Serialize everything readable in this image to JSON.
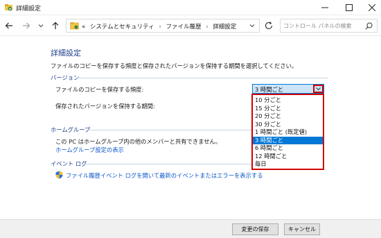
{
  "window": {
    "title": "詳細設定"
  },
  "address": {
    "overflow": "«",
    "crumbs": [
      "システムとセキュリティ",
      "ファイル履歴",
      "詳細設定"
    ],
    "separator": "›"
  },
  "search": {
    "placeholder": "コントロール パネルの検索"
  },
  "main": {
    "title": "詳細設定",
    "description": "ファイルのコピーを保存する頻度と保存されたバージョンを保持する期間を選択してください。",
    "versions": {
      "header": "バージョン",
      "frequency_label": "ファイルのコピーを保存する頻度:",
      "retention_label": "保存されたバージョンを保持する期間:",
      "frequency_value": "3 時間ごと",
      "options": [
        "10 分ごと",
        "15 分ごと",
        "20 分ごと",
        "30 分ごと",
        "1 時間ごと (既定値)",
        "3 時間ごと",
        "6 時間ごと",
        "12 時間ごと",
        "毎日"
      ],
      "selected_index": 5
    },
    "homegroup": {
      "header": "ホームグループ",
      "text": "この PC はホームグループ内の他のメンバーと共有できません。",
      "link": "ホームグループ設定の表示"
    },
    "eventlog": {
      "header": "イベント ログ",
      "link": "ファイル履歴イベント ログを開いて最新のイベントまたはエラーを表示する"
    }
  },
  "footer": {
    "save_label": "変更の保存",
    "cancel_label": "キャンセル"
  },
  "colors": {
    "heading": "#1e3f8a",
    "link": "#0b57c9",
    "selection": "#0078d7",
    "highlight_border": "#d10000"
  }
}
